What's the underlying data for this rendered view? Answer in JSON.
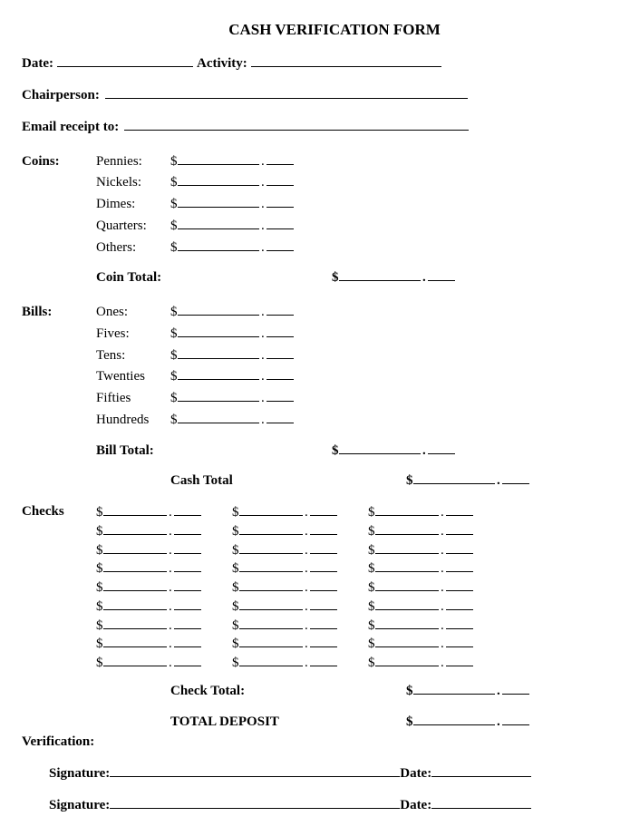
{
  "title": "CASH VERIFICATION FORM",
  "header": {
    "date_label": "Date:",
    "activity_label": "Activity:",
    "chairperson_label": "Chairperson:",
    "email_label": "Email receipt to:"
  },
  "coins": {
    "section": "Coins:",
    "items": [
      {
        "label": "Pennies:"
      },
      {
        "label": "Nickels:"
      },
      {
        "label": "Dimes:"
      },
      {
        "label": "Quarters:"
      },
      {
        "label": "Others:"
      }
    ],
    "total_label": "Coin Total:"
  },
  "bills": {
    "section": "Bills:",
    "items": [
      {
        "label": "Ones:"
      },
      {
        "label": "Fives:"
      },
      {
        "label": "Tens:"
      },
      {
        "label": "Twenties"
      },
      {
        "label": "Fifties"
      },
      {
        "label": "Hundreds"
      }
    ],
    "total_label": "Bill Total:"
  },
  "cash_total_label": "Cash Total",
  "checks": {
    "section": "Checks",
    "rows": 9,
    "cols": 3,
    "total_label": "Check Total:"
  },
  "total_deposit_label": "TOTAL DEPOSIT",
  "verification": {
    "section": "Verification:",
    "sig_label": "Signature:",
    "date_label": "Date:"
  },
  "dollar": "$"
}
